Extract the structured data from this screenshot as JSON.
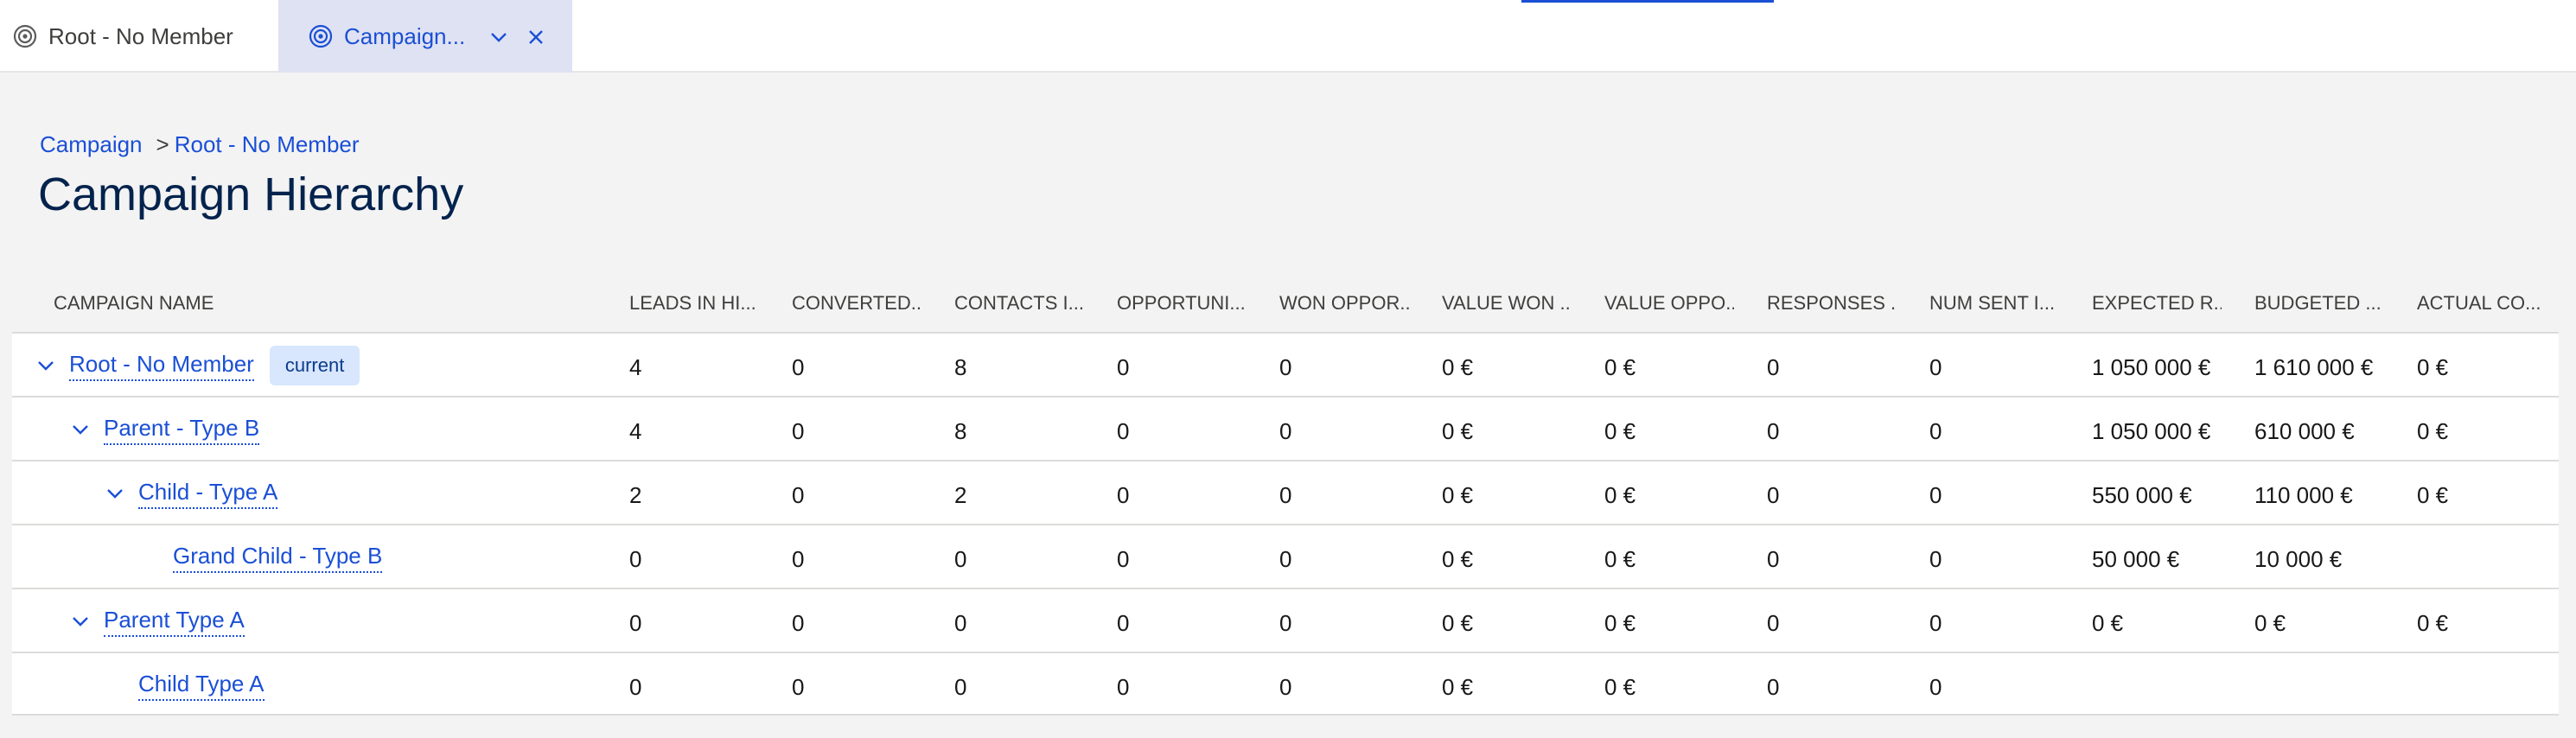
{
  "tabs": [
    {
      "label": "Root - No Member",
      "icon": "target-icon",
      "active": false
    },
    {
      "label": "Campaign...",
      "icon": "target-icon",
      "active": true
    }
  ],
  "breadcrumb": {
    "parent": "Campaign",
    "separator": ">",
    "current": "Root - No Member"
  },
  "page": {
    "title": "Campaign Hierarchy"
  },
  "columns": [
    "CAMPAIGN NAME",
    "LEADS IN HI...",
    "CONVERTED...",
    "CONTACTS I...",
    "OPPORTUNI...",
    "WON OPPOR...",
    "VALUE WON ...",
    "VALUE OPPO...",
    "RESPONSES ...",
    "NUM SENT I...",
    "EXPECTED R...",
    "BUDGETED ...",
    "ACTUAL CO..."
  ],
  "rows": [
    {
      "name": "Root - No Member",
      "badge": "current",
      "values": [
        "4",
        "0",
        "8",
        "0",
        "0",
        "0 €",
        "0 €",
        "0",
        "0",
        "1 050 000 €",
        "1 610 000 €",
        "0 €"
      ]
    },
    {
      "name": "Parent - Type B",
      "values": [
        "4",
        "0",
        "8",
        "0",
        "0",
        "0 €",
        "0 €",
        "0",
        "0",
        "1 050 000 €",
        "610 000 €",
        "0 €"
      ]
    },
    {
      "name": "Child - Type A",
      "values": [
        "2",
        "0",
        "2",
        "0",
        "0",
        "0 €",
        "0 €",
        "0",
        "0",
        "550 000 €",
        "110 000 €",
        "0 €"
      ]
    },
    {
      "name": "Grand Child - Type B",
      "values": [
        "0",
        "0",
        "0",
        "0",
        "0",
        "0 €",
        "0 €",
        "0",
        "0",
        "50 000 €",
        "10 000 €",
        ""
      ]
    },
    {
      "name": "Parent Type A",
      "values": [
        "0",
        "0",
        "0",
        "0",
        "0",
        "0 €",
        "0 €",
        "0",
        "0",
        "0 €",
        "0 €",
        "0 €"
      ]
    },
    {
      "name": "Child Type A",
      "values": [
        "0",
        "0",
        "0",
        "0",
        "0",
        "0 €",
        "0 €",
        "0",
        "0",
        "",
        "",
        ""
      ]
    }
  ],
  "colors": {
    "link": "#1a4fd6",
    "activeTab": "#dfe2f2",
    "badge": "#d8e6fe",
    "title": "#03234d"
  }
}
